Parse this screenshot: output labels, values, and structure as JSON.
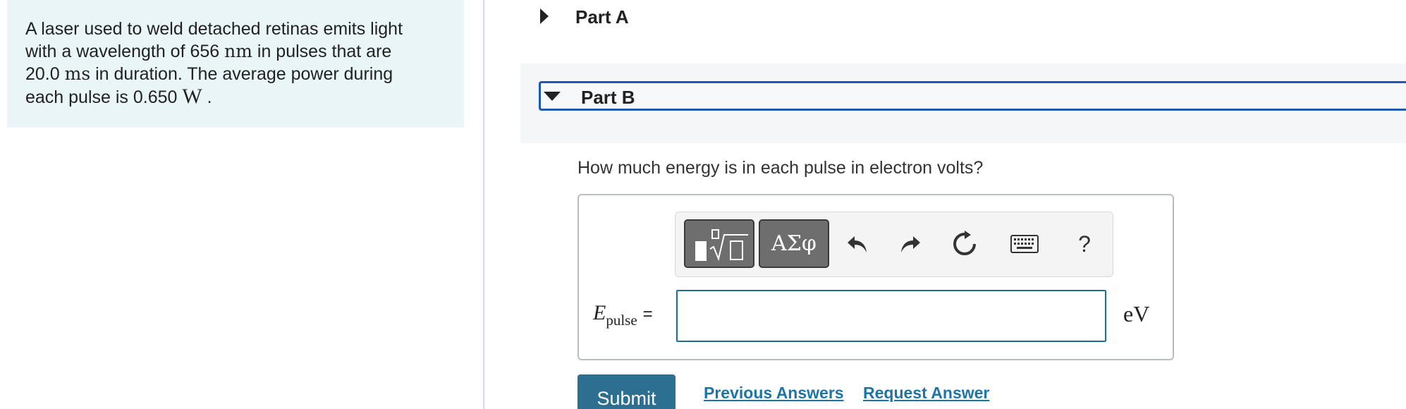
{
  "intro": {
    "line1": "A laser used to weld detached retinas emits light",
    "line2a": "with a wavelength of 656 ",
    "line2b": "nm",
    "line2c": " in pulses that are",
    "line3a": "20.0 ",
    "line3b": "ms",
    "line3c": " in duration. The average power during",
    "line4a": "each pulse is 0.650 ",
    "line4b": "W",
    "line4c": " ."
  },
  "parts": {
    "a": {
      "label": "Part A",
      "expanded": false
    },
    "b": {
      "label": "Part B",
      "expanded": true
    }
  },
  "question": "How much energy is in each pulse in electron volts?",
  "toolbar": {
    "templates_icon": "templates-sqrt-icon",
    "greek_label": "ΑΣφ",
    "undo_icon": "undo-icon",
    "redo_icon": "redo-icon",
    "reset_icon": "reset-icon",
    "keyboard_icon": "keyboard-icon",
    "help_label": "?"
  },
  "answer": {
    "variable": "E",
    "subscript": "pulse",
    "equals": "=",
    "value": "",
    "unit": "eV"
  },
  "actions": {
    "submit_label": "Submit",
    "previous_answers_label": "Previous Answers",
    "request_answer_label": "Request Answer"
  },
  "colors": {
    "intro_bg": "#e9f5f6",
    "focus_border": "#2057b5",
    "submit_bg": "#2d6f91",
    "link": "#1d74a8",
    "input_border": "#1b6f8f"
  }
}
